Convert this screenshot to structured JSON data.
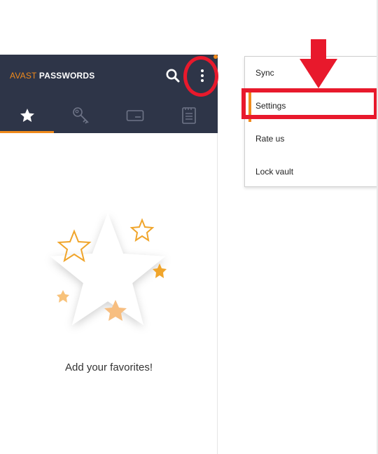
{
  "app": {
    "brand_prefix": "AVAST",
    "brand_suffix": "PASSWORDS"
  },
  "tabs": [
    {
      "icon": "star-icon",
      "active": true
    },
    {
      "icon": "key-icon",
      "active": false
    },
    {
      "icon": "card-icon",
      "active": false
    },
    {
      "icon": "note-icon",
      "active": false
    }
  ],
  "empty_state": {
    "text": "Add your favorites!"
  },
  "menu": {
    "items": [
      {
        "label": "Sync"
      },
      {
        "label": "Settings"
      },
      {
        "label": "Rate us"
      },
      {
        "label": "Lock vault"
      }
    ]
  },
  "colors": {
    "appbar": "#2e3548",
    "accent": "#f08a1c",
    "highlight": "#e8192c"
  }
}
